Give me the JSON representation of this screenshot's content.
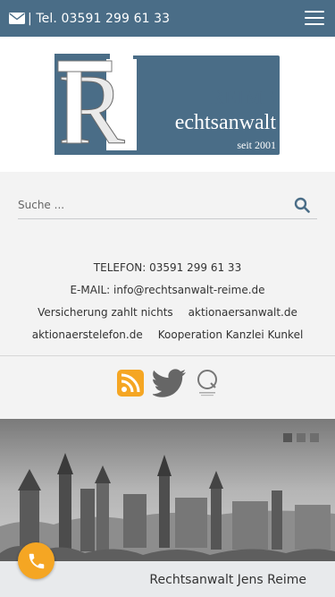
{
  "header": {
    "phone_text": "| Tel. 03591 299 61 33",
    "bar_color": "#4a6d87",
    "icons": {
      "mail": "envelope-icon",
      "menu": "hamburger-menu-icon"
    }
  },
  "logo": {
    "line1": "REIME",
    "line2": "echtsanwalt",
    "line3": "seit 2001",
    "monogram": "R",
    "brand_color": "#4a6d87"
  },
  "search": {
    "placeholder": "Suche ...",
    "icon": "search-icon"
  },
  "contact": {
    "telefon": "TELEFON: 03591 299 61 33",
    "email": "E-MAIL: info@rechtsanwalt-reime.de",
    "links_row1": [
      "Versicherung zahlt nichts",
      "aktionaersanwalt.de"
    ],
    "links_row2": [
      "aktionaerstelefon.de",
      "Kooperation Kanzlei Kunkel"
    ]
  },
  "social": {
    "icons": [
      "rss-icon",
      "twitter-icon",
      "q-badge-icon"
    ],
    "rss_color": "#f5a623"
  },
  "slider": {
    "caption": "Rechtsanwalt Jens Reime",
    "slide_count": 3,
    "fab_icon": "phone-icon",
    "fab_color": "#f5a623"
  }
}
